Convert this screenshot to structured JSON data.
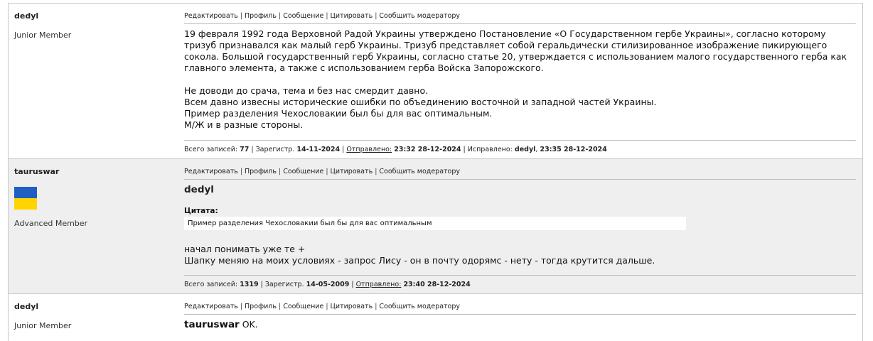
{
  "actions": {
    "edit": "Редактировать",
    "profile": "Профиль",
    "message": "Сообщение",
    "quote": "Цитировать",
    "report": "Сообщить модератору"
  },
  "labels": {
    "total_posts": "Всего записей:",
    "registered": "Зарегистр.",
    "sent": "Отправлено:",
    "edited": "Исправлено:"
  },
  "posts": [
    {
      "author": "dedyl",
      "rank": "Junior Member",
      "paragraphs": [
        "19 февраля 1992 года Верховной Радой Украины утверждено Постановление «О Государственном гербе Украины», согласно которому тризуб признавался как малый герб Украины. Тризуб представляет собой геральдически стилизированное изображение пикирующего сокола. Большой государственный герб Украины, согласно статье 20, утверждается с использованием малого государственного герба как главного элемента, а также с использованием герба Войска Запорожского.",
        "Не доводи до срача, тема и без нас смердит давно.",
        "Всем давно извесны исторические ошибки по объединению восточной и западной частей Украины.",
        "Пример разделения Чехословакии был бы для вас оптимальным.",
        "М/Ж  и в разные стороны."
      ],
      "total_posts": "77",
      "registered": "14-11-2024",
      "sent": "23:32 28-12-2024",
      "edited_by": "dedyl",
      "edited_at": "23:35 28-12-2024"
    },
    {
      "author": "taurus war",
      "author_display": "tauruswar",
      "rank": "Advanced Member",
      "flag_colors": [
        "#1f5fc4",
        "#ffd400"
      ],
      "quote_author": "dedyl",
      "quote_label": "Цитата:",
      "quote_text": "Пример разделения Чехословакии был бы для вас оптимальным",
      "paragraphs": [
        "начал понимать уже те +",
        "Шапку меняю на моих условиях - запрос Лису - он в почту одорямс - нету - тогда крутится дальше."
      ],
      "total_posts": "1319",
      "registered": "14-05-2009",
      "sent": "23:40 28-12-2024"
    },
    {
      "author": "dedyl",
      "rank": "Junior Member",
      "reply_to": "tauruswar",
      "reply_text": " OK."
    }
  ]
}
